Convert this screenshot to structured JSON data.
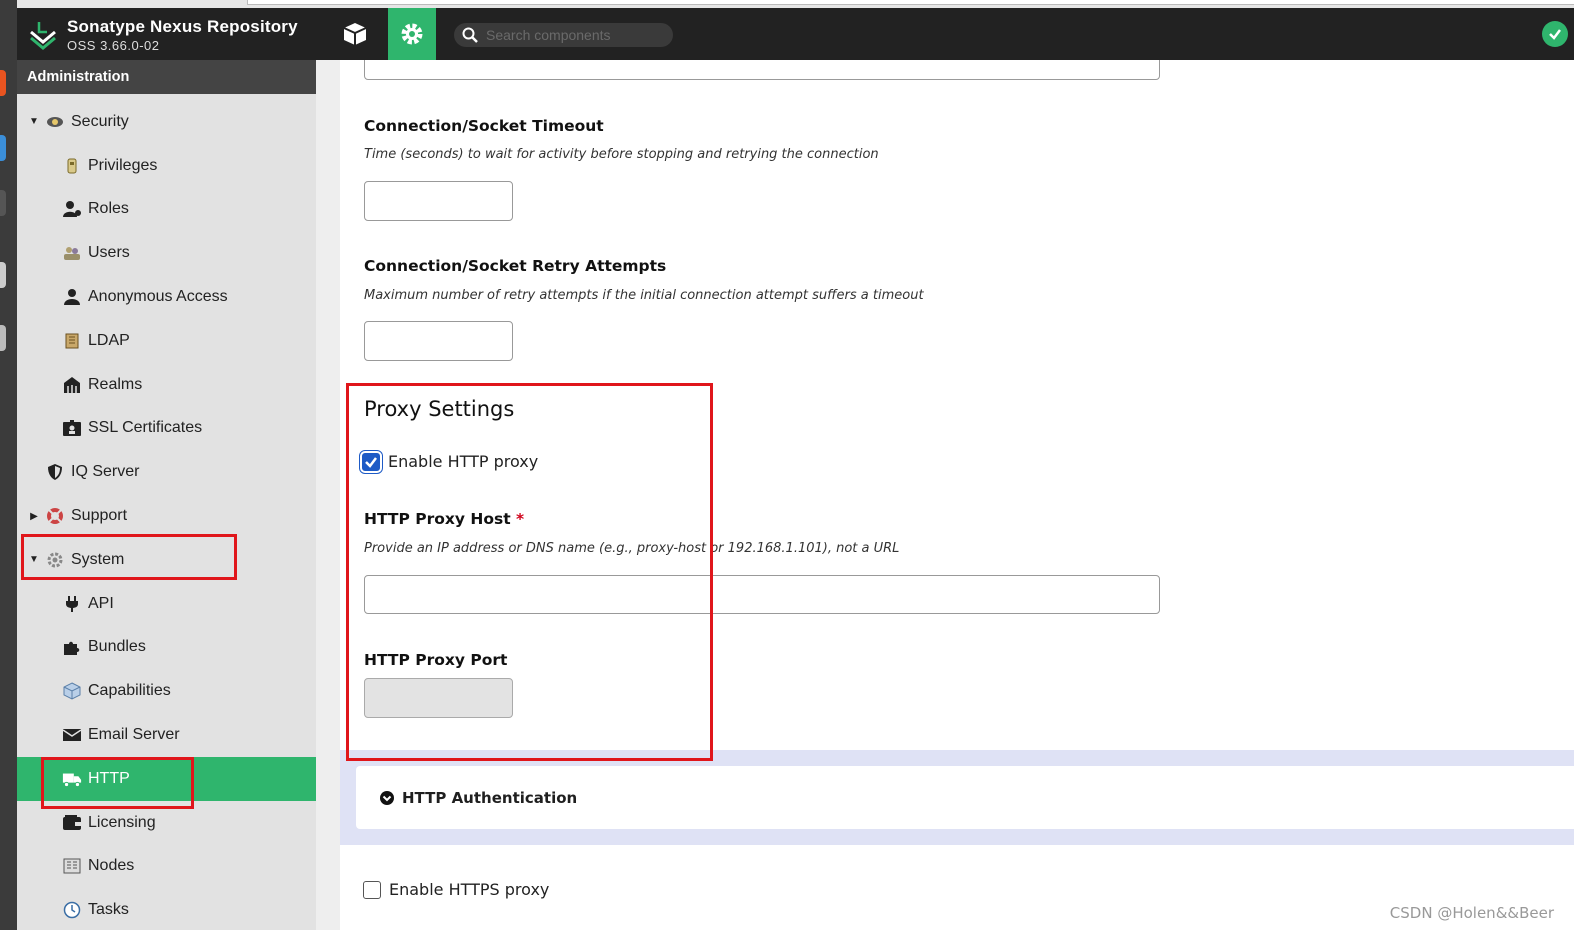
{
  "app": {
    "title": "Sonatype Nexus Repository",
    "version": "OSS 3.66.0-02"
  },
  "header": {
    "search_placeholder": "Search components"
  },
  "sidebar": {
    "header": "Administration",
    "items": [
      {
        "label": "Security",
        "icon": "security-icon",
        "level": 1,
        "caret": "down"
      },
      {
        "label": "Privileges",
        "icon": "privileges-icon",
        "level": 2
      },
      {
        "label": "Roles",
        "icon": "roles-icon",
        "level": 2
      },
      {
        "label": "Users",
        "icon": "users-icon",
        "level": 2
      },
      {
        "label": "Anonymous Access",
        "icon": "anonymous-icon",
        "level": 2
      },
      {
        "label": "LDAP",
        "icon": "ldap-icon",
        "level": 2
      },
      {
        "label": "Realms",
        "icon": "realms-icon",
        "level": 2
      },
      {
        "label": "SSL Certificates",
        "icon": "ssl-icon",
        "level": 2
      },
      {
        "label": "IQ Server",
        "icon": "shield-icon",
        "level": 1,
        "caret": "none"
      },
      {
        "label": "Support",
        "icon": "support-icon",
        "level": 1,
        "caret": "right"
      },
      {
        "label": "System",
        "icon": "gear-icon",
        "level": 1,
        "caret": "down"
      },
      {
        "label": "API",
        "icon": "plug-icon",
        "level": 2
      },
      {
        "label": "Bundles",
        "icon": "puzzle-icon",
        "level": 2
      },
      {
        "label": "Capabilities",
        "icon": "cube-icon",
        "level": 2
      },
      {
        "label": "Email Server",
        "icon": "envelope-icon",
        "level": 2
      },
      {
        "label": "HTTP",
        "icon": "truck-icon",
        "level": 2,
        "active": true
      },
      {
        "label": "Licensing",
        "icon": "wallet-icon",
        "level": 2
      },
      {
        "label": "Nodes",
        "icon": "nodes-icon",
        "level": 2
      },
      {
        "label": "Tasks",
        "icon": "clock-icon",
        "level": 2
      }
    ]
  },
  "form": {
    "timeout": {
      "label": "Connection/Socket Timeout",
      "help": "Time (seconds) to wait for activity before stopping and retrying the connection",
      "value": ""
    },
    "retry": {
      "label": "Connection/Socket Retry Attempts",
      "help": "Maximum number of retry attempts if the initial connection attempt suffers a timeout",
      "value": ""
    },
    "proxy_title": "Proxy Settings",
    "enable_http_proxy": {
      "label": "Enable HTTP proxy",
      "checked": true
    },
    "proxy_host": {
      "label": "HTTP Proxy Host",
      "required_mark": "*",
      "help": "Provide an IP address or DNS name (e.g., proxy-host or 192.168.1.101), not a URL",
      "value": ""
    },
    "proxy_port": {
      "label": "HTTP Proxy Port",
      "value": ""
    },
    "http_auth": {
      "label": "HTTP Authentication"
    },
    "enable_https_proxy": {
      "label": "Enable HTTPS proxy",
      "checked": false
    }
  },
  "watermark": "CSDN @Holen&&Beer",
  "colors": {
    "accent": "#2fb56d",
    "topbar": "#222222",
    "highlight": "#e0161b",
    "checkbox": "#1e5bc6"
  }
}
